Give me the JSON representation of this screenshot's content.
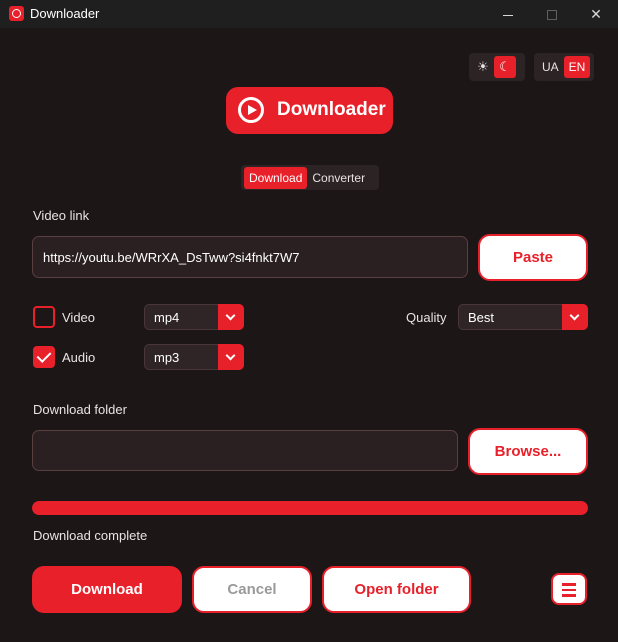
{
  "window": {
    "title": "Downloader",
    "minimize_icon": "minimize-icon",
    "maximize_icon": "maximize-icon",
    "close_glyph": "✕"
  },
  "theme_toggle": {
    "light_glyph": "☀",
    "dark_glyph": "☾",
    "active": "dark"
  },
  "language_toggle": {
    "options": [
      "UA",
      "EN"
    ],
    "active": "EN"
  },
  "logo": {
    "text": "Downloader",
    "icon": "play-circle-icon"
  },
  "tabs": {
    "items": [
      "Download",
      "Converter"
    ],
    "active": "Download"
  },
  "video_link": {
    "label": "Video link",
    "value": "https://youtu.be/WRrXA_DsTww?si4fnkt7W7",
    "paste_label": "Paste"
  },
  "options": {
    "video": {
      "label": "Video",
      "checked": false,
      "format": "mp4"
    },
    "audio": {
      "label": "Audio",
      "checked": true,
      "format": "mp3"
    },
    "quality": {
      "label": "Quality",
      "value": "Best"
    }
  },
  "download_folder": {
    "label": "Download folder",
    "value": "",
    "browse_label": "Browse..."
  },
  "progress": {
    "fraction": 1.0,
    "status": "Download complete"
  },
  "actions": {
    "download_label": "Download",
    "cancel_label": "Cancel",
    "open_folder_label": "Open folder",
    "menu_icon": "menu-icon"
  },
  "colors": {
    "accent": "#e8202a",
    "background": "#1c1617"
  }
}
